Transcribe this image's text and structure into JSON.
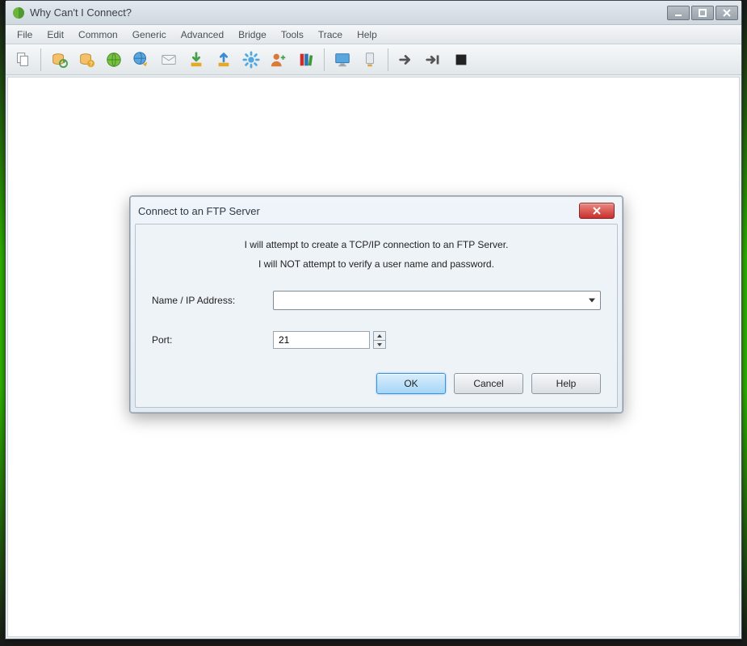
{
  "window": {
    "title": "Why Can't I Connect?"
  },
  "menubar": {
    "items": [
      "File",
      "Edit",
      "Common",
      "Generic",
      "Advanced",
      "Bridge",
      "Tools",
      "Trace",
      "Help"
    ]
  },
  "toolbar": {
    "icons": [
      "copy",
      "db-refresh",
      "db-question",
      "globe",
      "globe-arrow",
      "mail",
      "download",
      "upload",
      "gear",
      "user-add",
      "books",
      "monitor",
      "host",
      "arrow-right",
      "arrow-skip",
      "stop"
    ]
  },
  "dialog": {
    "title": "Connect to an FTP Server",
    "message1": "I will attempt to create a TCP/IP connection to an FTP Server.",
    "message2": "I will NOT attempt to verify a user name and password.",
    "name_ip_label": "Name / IP Address:",
    "name_ip_value": "",
    "port_label": "Port:",
    "port_value": "21",
    "ok_label": "OK",
    "cancel_label": "Cancel",
    "help_label": "Help"
  }
}
